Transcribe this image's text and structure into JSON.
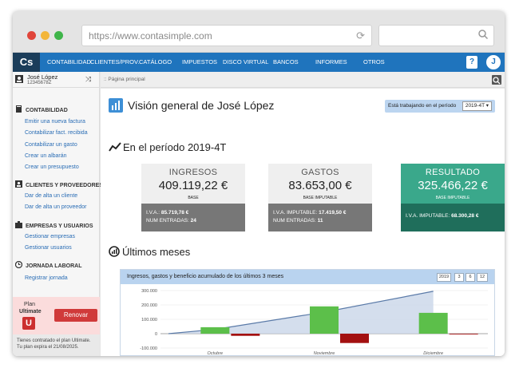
{
  "browser": {
    "url": "https://www.contasimple.com",
    "dots": [
      "#e0453a",
      "#f3b63a",
      "#3fb54a"
    ]
  },
  "topnav": {
    "logo": "Cs",
    "items": [
      "CONTABILIDAD",
      "CLIENTES/PROV.",
      "CATÁLOGO",
      "IMPUESTOS",
      "DISCO VIRTUAL",
      "BANCOS",
      "INFORMES",
      "OTROS"
    ],
    "help": "?",
    "avatar": "J",
    "color": "#1f74bd"
  },
  "user": {
    "name": "José López",
    "nif": "12345678Z"
  },
  "breadcrumb": ":: Página principal",
  "sidebar": {
    "sections": [
      {
        "title": "CONTABILIDAD",
        "links": [
          "Emitir una nueva factura",
          "Contabilizar fact. recibida",
          "Contabilizar un gasto",
          "Crear un albarán",
          "Crear un presupuesto"
        ]
      },
      {
        "title": "CLIENTES Y PROVEEDORES",
        "links": [
          "Dar de alta un cliente",
          "Dar de alta un proveedor"
        ]
      },
      {
        "title": "EMPRESAS Y USUARIOS",
        "links": [
          "Gestionar empresas",
          "Gestionar usuarios"
        ]
      },
      {
        "title": "JORNADA LABORAL",
        "links": [
          "Registrar jornada"
        ]
      }
    ]
  },
  "plan": {
    "label_1": "Plan",
    "label_2": "Ultimate",
    "badge": "U",
    "renew": "Renovar",
    "note_1": "Tienes contratado el plan Ultimate.",
    "note_2": "Tu plan expira el 21/08/2025."
  },
  "main": {
    "title": "Visión general de José López",
    "period_label": "Está trabajando en el período",
    "period_value": "2019-4T ▾",
    "section_title": "En el período 2019-4T",
    "cards": {
      "ingresos": {
        "label": "INGRESOS",
        "amount": "409.119,22 €",
        "base": "BASE",
        "line1_label": "I.V.A.:",
        "line1_value": "85.719,78 €",
        "line2_label": "NUM ENTRADAS:",
        "line2_value": "24"
      },
      "gastos": {
        "label": "GASTOS",
        "amount": "83.653,00 €",
        "base": "BASE IMPUTABLE",
        "line1_label": "I.V.A. IMPUTABLE:",
        "line1_value": "17.419,50 €",
        "line2_label": "NUM ENTRADAS:",
        "line2_value": "11"
      },
      "resultado": {
        "label": "RESULTADO",
        "amount": "325.466,22 €",
        "base": "BASE IMPUTABLE",
        "line1_label": "I.V.A. IMPUTABLE:",
        "line1_value": "68.300,28 €"
      }
    },
    "ultimos_title": "Últimos meses",
    "chart_header": "Ingresos, gastos y beneficio acumulado de los últimos 3 meses",
    "period_buttons": [
      "2019",
      "3",
      "6",
      "12"
    ]
  },
  "chart_data": {
    "type": "bar",
    "categories": [
      "Octubre",
      "Noviembre",
      "Diciembre"
    ],
    "series": [
      {
        "values": [
          45000,
          190000,
          145000
        ],
        "color": "#5cbf4a"
      },
      {
        "values": [
          -15000,
          -65000,
          -5000
        ],
        "color": "#a31010"
      },
      {
        "values": [
          30000,
          150000,
          295000
        ],
        "color": "#5a7aa8"
      }
    ],
    "yticks": [
      "300.000",
      "200.000",
      "100.000",
      "0",
      "-100.000"
    ],
    "ylim": [
      -100000,
      300000
    ]
  }
}
